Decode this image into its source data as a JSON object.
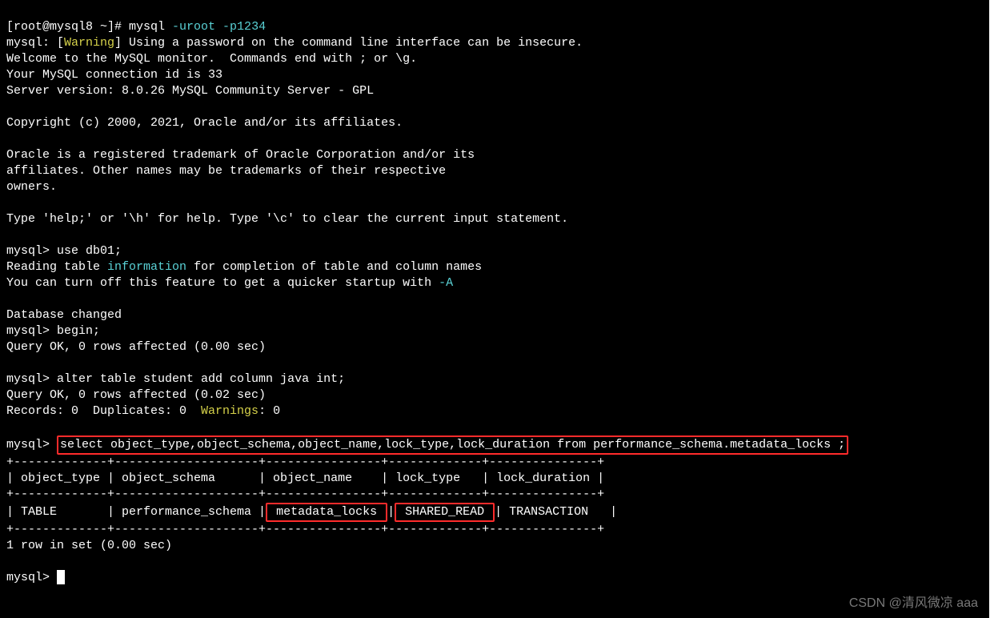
{
  "prompt_shell": "[root@mysql8 ~]# ",
  "mysql_cmd_prefix": "mysql ",
  "mysql_cmd_flags": "-uroot -p1234",
  "mysql_warning_open": "mysql: [",
  "warning_word": "Warning",
  "mysql_warning_rest": "] Using a password on the command line interface can be insecure.",
  "welcome_lines": "Welcome to the MySQL monitor.  Commands end with ; or \\g.\nYour MySQL connection id is 33\nServer version: 8.0.26 MySQL Community Server - GPL\n\nCopyright (c) 2000, 2021, Oracle and/or its affiliates.\n\nOracle is a registered trademark of Oracle Corporation and/or its\naffiliates. Other names may be trademarks of their respective\nowners.\n\nType 'help;' or '\\h' for help. Type '\\c' to clear the current input statement.\n",
  "mysql_prompt": "mysql> ",
  "use_cmd": "use db01;",
  "reading_pre": "Reading table ",
  "information_word": "information",
  "reading_post": " for completion of table and column names",
  "turnoff_pre": "You can turn off this feature to get a quicker startup with ",
  "dash_a": "-A",
  "db_changed": "\nDatabase changed",
  "begin_cmd": "begin;",
  "begin_result": "Query OK, 0 rows affected (0.00 sec)\n",
  "alter_cmd": "alter table student add column java int;",
  "alter_result": "Query OK, 0 rows affected (0.02 sec)",
  "records_pre": "Records: 0  Duplicates: 0  ",
  "warnings_word": "Warnings",
  "records_post": ": 0\n",
  "select_cmd": "select object_type,object_schema,object_name,lock_type,lock_duration from performance_schema.metadata_locks ;",
  "table_sep": "+-------------+--------------------+----------------+-------------+---------------+",
  "table_header": "| object_type | object_schema      | object_name    | lock_type   | lock_duration |",
  "row_col1_2": "| TABLE       | performance_schema |",
  "row_col3": " metadata_locks ",
  "row_sep1": "|",
  "row_col4": " SHARED_READ ",
  "row_rest": "| TRANSACTION   |",
  "rows_in_set": "1 row in set (0.00 sec)\n",
  "watermark": "CSDN @清风微凉 aaa"
}
